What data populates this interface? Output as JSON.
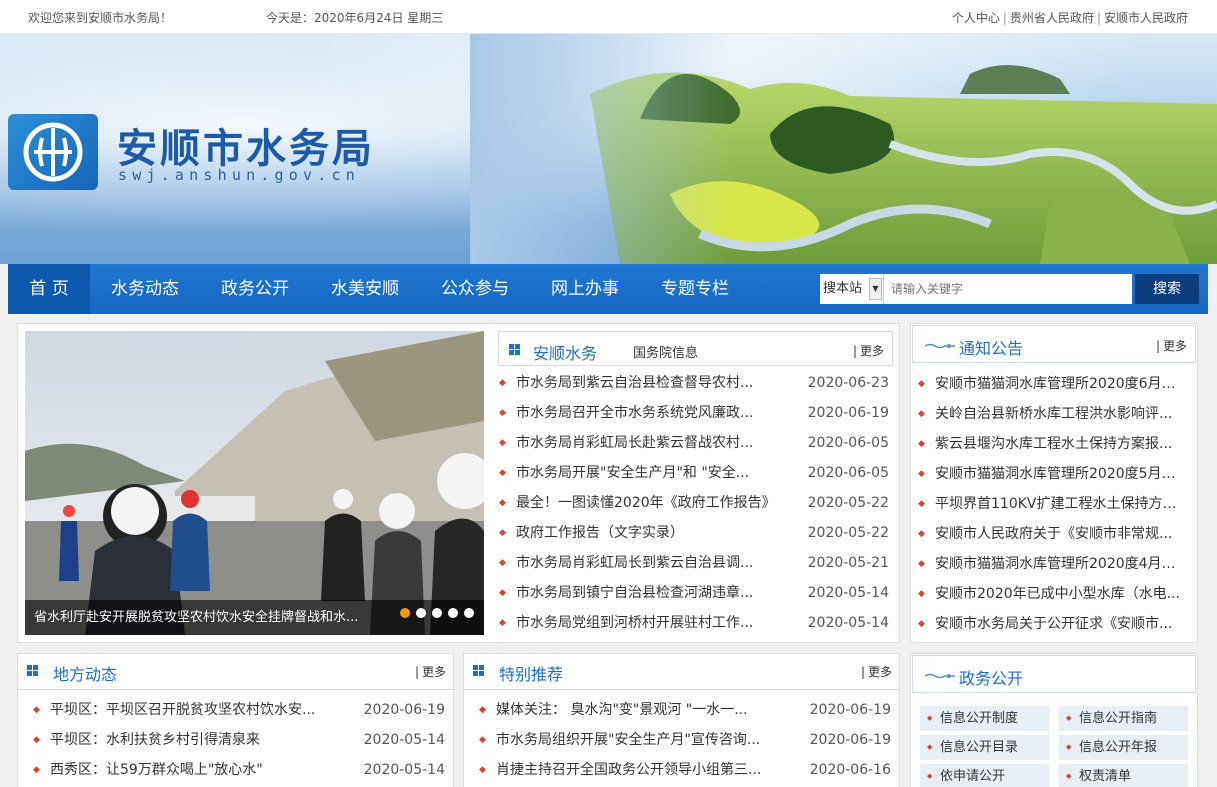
{
  "topbar": {
    "welcome": "欢迎您来到安顺市水务局！",
    "date": "今天是：2020年6月24日 星期三",
    "links": [
      "个人中心",
      "贵州省人民政府",
      "安顺市人民政府"
    ]
  },
  "banner": {
    "site_name": "安顺市水务局",
    "site_url": "swj.anshun.gov.cn"
  },
  "nav": {
    "items": [
      "首 页",
      "水务动态",
      "政务公开",
      "水美安顺",
      "公众参与",
      "网上办事",
      "专题专栏"
    ],
    "site_select": "搜本站",
    "search_placeholder": "请输入关键字",
    "search_button": "搜索"
  },
  "slider": {
    "caption": "省水利厅赴安开展脱贫攻坚农村饮水安全挂牌督战和水...",
    "dots": 5,
    "active_dot": 0
  },
  "anshun_water": {
    "tab_active": "安顺水务",
    "tab_other": "国务院信息",
    "more": "更多",
    "items": [
      {
        "text": "市水务局到紫云自治县检查督导农村...",
        "date": "2020-06-23"
      },
      {
        "text": "市水务局召开全市水务系统党风廉政...",
        "date": "2020-06-19"
      },
      {
        "text": "市水务局肖彩虹局长赴紫云督战农村...",
        "date": "2020-06-05"
      },
      {
        "text": "市水务局开展\"安全生产月\"和 \"安全...",
        "date": "2020-06-05"
      },
      {
        "text": "最全！一图读懂2020年《政府工作报告》",
        "date": "2020-05-22"
      },
      {
        "text": "政府工作报告（文字实录）",
        "date": "2020-05-22"
      },
      {
        "text": "市水务局肖彩虹局长到紫云自治县调...",
        "date": "2020-05-21"
      },
      {
        "text": "市水务局到镇宁自治县检查河湖违章...",
        "date": "2020-05-14"
      },
      {
        "text": "市水务局党组到河桥村开展驻村工作...",
        "date": "2020-05-14"
      }
    ]
  },
  "notices": {
    "title": "通知公告",
    "more": "更多",
    "items": [
      "安顺市猫猫洞水库管理所2020度6月份...",
      "关岭自治县新桥水库工程洪水影响评...",
      "紫云县堰沟水库工程水土保持方案报...",
      "安顺市猫猫洞水库管理所2020度5月份...",
      "平坝界首110KV扩建工程水土保持方案...",
      "安顺市人民政府关于《安顺市非常规...",
      "安顺市猫猫洞水库管理所2020度4月份...",
      "安顺市2020年已成中小型水库（水电...",
      "安顺市水务局关于公开征求《安顺市..."
    ]
  },
  "local_news": {
    "title": "地方动态",
    "more": "更多",
    "items": [
      {
        "text": "平坝区：平坝区召开脱贫攻坚农村饮水安...",
        "date": "2020-06-19"
      },
      {
        "text": "平坝区：水利扶贫乡村引得清泉来",
        "date": "2020-05-14"
      },
      {
        "text": "西秀区：让59万群众喝上\"放心水\"",
        "date": "2020-05-14"
      }
    ]
  },
  "featured": {
    "title": "特别推荐",
    "more": "更多",
    "items": [
      {
        "text": "媒体关注： 臭水沟\"变\"景观河 \"一水一...",
        "date": "2020-06-19"
      },
      {
        "text": "市水务局组织开展\"安全生产月\"宣传咨询...",
        "date": "2020-06-19"
      },
      {
        "text": "肖捷主持召开全国政务公开领导小组第三...",
        "date": "2020-06-16"
      }
    ]
  },
  "gov_open": {
    "title": "政务公开",
    "cells": [
      "信息公开制度",
      "信息公开指南",
      "信息公开目录",
      "信息公开年报",
      "依申请公开",
      "权责清单"
    ]
  }
}
